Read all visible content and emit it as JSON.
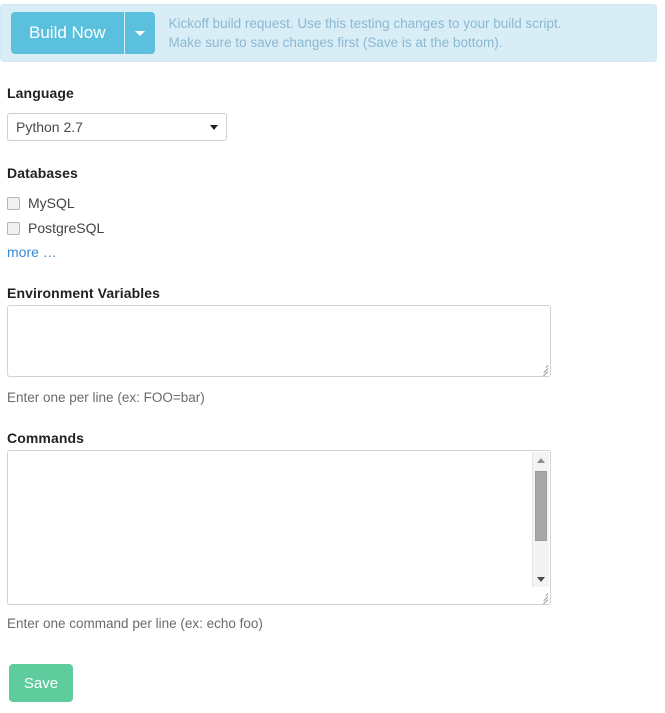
{
  "build_banner": {
    "button_label": "Build Now",
    "dropdown_icon": "caret-down-icon",
    "message_line1": "Kickoff build request. Use this testing changes to your build script.",
    "message_line2": "Make sure to save changes first (Save is at the bottom).",
    "background_color": "#d9edf7",
    "button_color": "#5bc0de",
    "text_color": "#8ab9d1"
  },
  "language": {
    "label": "Language",
    "selected": "Python 2.7",
    "arrow_icon": "triangle-down-icon"
  },
  "databases": {
    "label": "Databases",
    "options": [
      {
        "label": "MySQL",
        "checked": false
      },
      {
        "label": "PostgreSQL",
        "checked": false
      }
    ],
    "more_link": "more …",
    "link_color": "#3a87d6"
  },
  "env_vars": {
    "label": "Environment Variables",
    "value": "",
    "help": "Enter one per line (ex: FOO=bar)",
    "resize_icon": "resize-grip-icon"
  },
  "commands": {
    "label": "Commands",
    "value": "",
    "help": "Enter one command per line (ex: echo foo)",
    "scrollbar": {
      "up_icon": "scroll-up-arrow-icon",
      "down_icon": "scroll-down-arrow-icon",
      "thumb": "scrollbar-thumb"
    },
    "resize_icon": "resize-grip-icon"
  },
  "save": {
    "label": "Save",
    "color": "#5ecc9d"
  }
}
